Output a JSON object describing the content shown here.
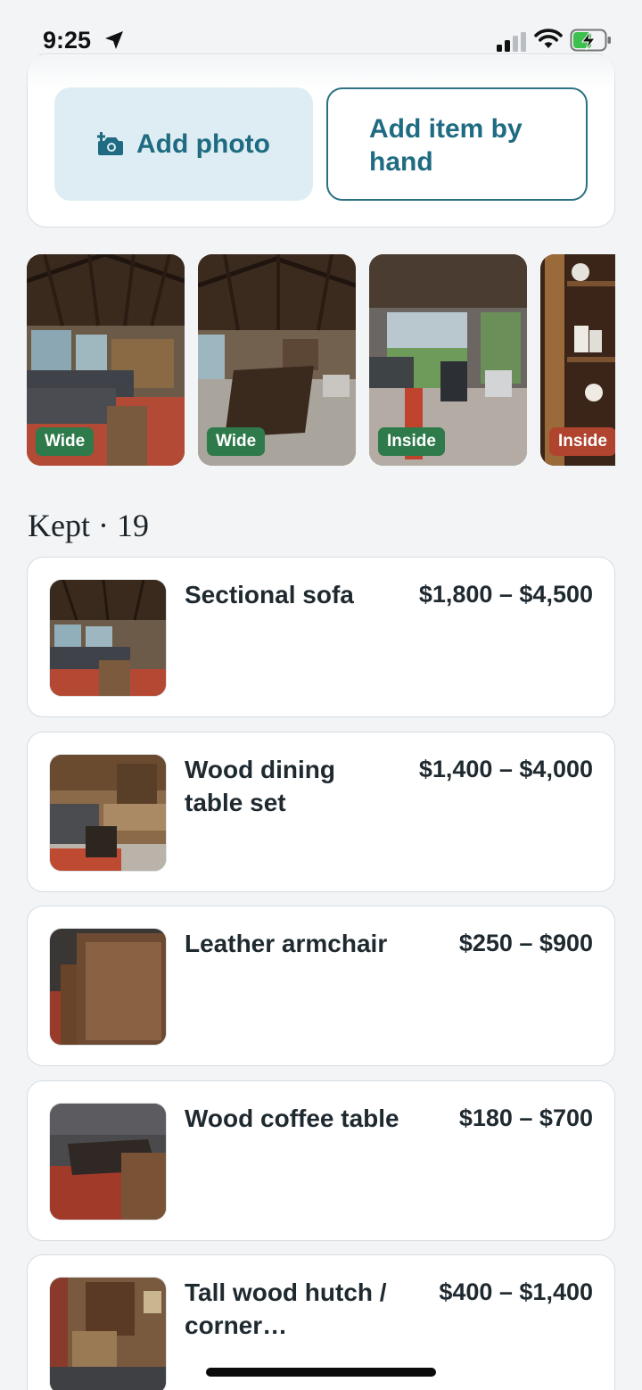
{
  "status_bar": {
    "time": "9:25",
    "icons": [
      "location-arrow-icon",
      "signal-icon",
      "wifi-icon",
      "battery-charging-icon"
    ]
  },
  "actions": {
    "add_photo_label": "Add photo",
    "add_photo_icon": "camera-plus-icon",
    "add_by_hand_label": "Add item by hand"
  },
  "photos": [
    {
      "tag": "Wide",
      "tag_color": "#2f7a4a"
    },
    {
      "tag": "Wide",
      "tag_color": "#2f7a4a"
    },
    {
      "tag": "Inside",
      "tag_color": "#2f7a4a"
    },
    {
      "tag": "Inside",
      "tag_color": "#b0442f"
    }
  ],
  "kept": {
    "heading": "Kept · 19"
  },
  "items": [
    {
      "name": "Sectional sofa",
      "price": "$1,800 – $4,500"
    },
    {
      "name": "Wood dining table set",
      "price": "$1,400 – $4,000"
    },
    {
      "name": "Leather armchair",
      "price": "$250 – $900"
    },
    {
      "name": "Wood coffee table",
      "price": "$180 – $700"
    },
    {
      "name": "Tall wood hutch / corner…",
      "price": "$400 – $1,400"
    }
  ],
  "colors": {
    "accent": "#1e6b82",
    "accent_bg": "#deedf3",
    "background": "#f2f4f6",
    "tag_green": "#2f7a4a",
    "tag_red": "#b0442f"
  }
}
